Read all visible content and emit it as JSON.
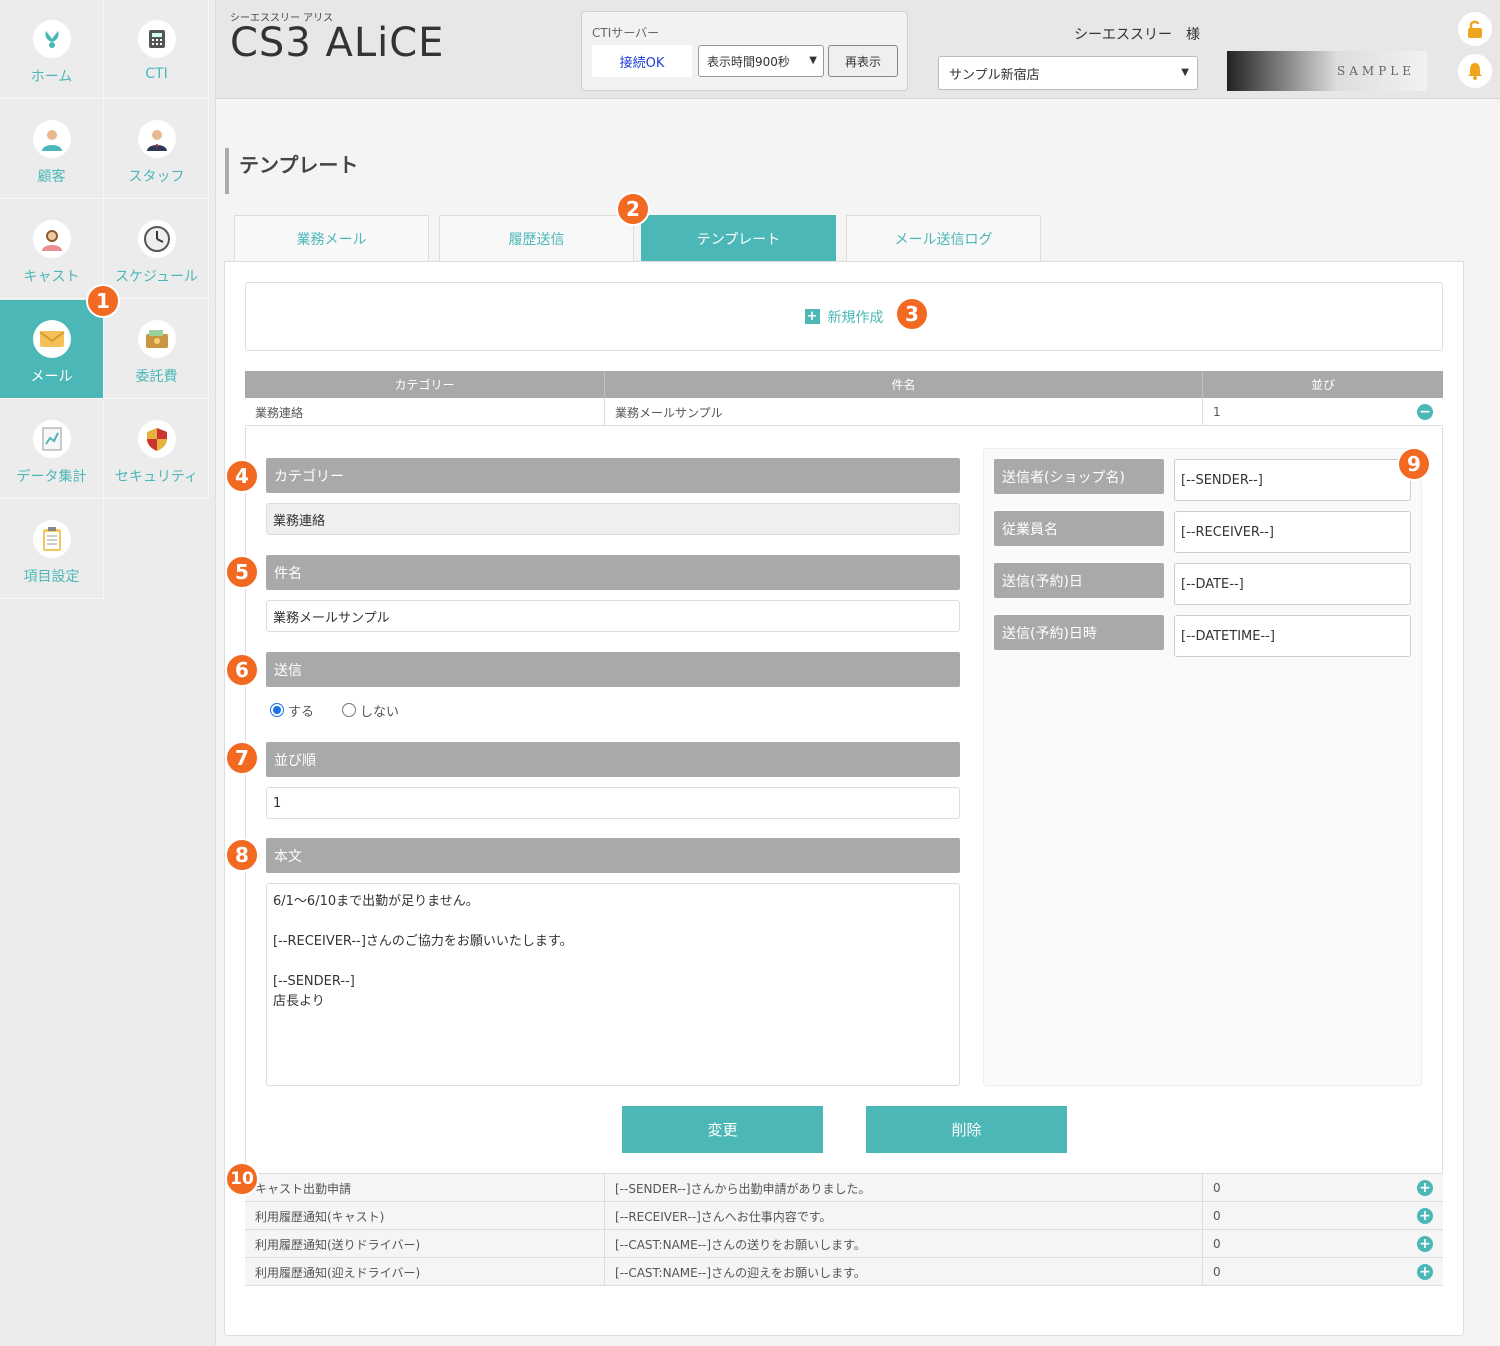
{
  "sidebar": {
    "items": [
      {
        "label": "ホーム",
        "icon": "rabbit-icon"
      },
      {
        "label": "CTI",
        "icon": "phone-icon"
      },
      {
        "label": "顧客",
        "icon": "customer-icon"
      },
      {
        "label": "スタッフ",
        "icon": "staff-icon"
      },
      {
        "label": "キャスト",
        "icon": "cast-icon"
      },
      {
        "label": "スケジュール",
        "icon": "clock-icon"
      },
      {
        "label": "メール",
        "icon": "mail-icon"
      },
      {
        "label": "委託費",
        "icon": "wallet-icon"
      },
      {
        "label": "データ集計",
        "icon": "chart-icon"
      },
      {
        "label": "セキュリティ",
        "icon": "shield-icon"
      },
      {
        "label": "項目設定",
        "icon": "clipboard-icon"
      }
    ],
    "active_index": 6
  },
  "header": {
    "brand_sub": "シーエススリー アリス",
    "brand_title": "CS3 ALiCE",
    "cti_label": "CTIサーバー",
    "cti_status": "接続OK",
    "cti_time_select": "表示時間900秒",
    "cti_refresh": "再表示",
    "user_name": "シーエススリー　様",
    "shop_select": "サンプル新宿店",
    "shop_logo_text": "SAMPLE"
  },
  "page_title": "テンプレート",
  "tabs": [
    {
      "label": "業務メール"
    },
    {
      "label": "履歴送信"
    },
    {
      "label": "テンプレート"
    },
    {
      "label": "メール送信ログ"
    }
  ],
  "new_button": "新規作成",
  "table": {
    "headers": [
      "カテゴリー",
      "件名",
      "並び"
    ],
    "open_row": {
      "category": "業務連絡",
      "subject": "業務メールサンプル",
      "order": "1"
    },
    "rows": [
      {
        "category": "キャスト出勤申請",
        "subject": "[--SENDER--]さんから出勤申請がありました。",
        "order": "0"
      },
      {
        "category": "利用履歴通知(キャスト)",
        "subject": "[--RECEIVER--]さんへお仕事内容です。",
        "order": "0"
      },
      {
        "category": "利用履歴通知(送りドライバー)",
        "subject": "[--CAST:NAME--]さんの送りをお願いします。",
        "order": "0"
      },
      {
        "category": "利用履歴通知(迎えドライバー)",
        "subject": "[--CAST:NAME--]さんの迎えをお願いします。",
        "order": "0"
      }
    ]
  },
  "form": {
    "category_label": "カテゴリー",
    "category_value": "業務連絡",
    "subject_label": "件名",
    "subject_value": "業務メールサンプル",
    "send_label": "送信",
    "send_yes": "する",
    "send_no": "しない",
    "order_label": "並び順",
    "order_value": "1",
    "body_label": "本文",
    "body_lines": [
      "6/1～6/10まで出勤が足りません。",
      "",
      "[--RECEIVER--]さんのご協力をお願いいたします。",
      "",
      "[--SENDER--]",
      "店長より"
    ]
  },
  "placeholders": [
    {
      "label": "送信者(ショップ名)",
      "value": "[--SENDER--]"
    },
    {
      "label": "従業員名",
      "value": "[--RECEIVER--]"
    },
    {
      "label": "送信(予約)日",
      "value": "[--DATE--]"
    },
    {
      "label": "送信(予約)日時",
      "value": "[--DATETIME--]"
    }
  ],
  "actions": {
    "update": "変更",
    "delete": "削除"
  },
  "callouts": [
    "1",
    "2",
    "3",
    "4",
    "5",
    "6",
    "7",
    "8",
    "9",
    "10"
  ]
}
